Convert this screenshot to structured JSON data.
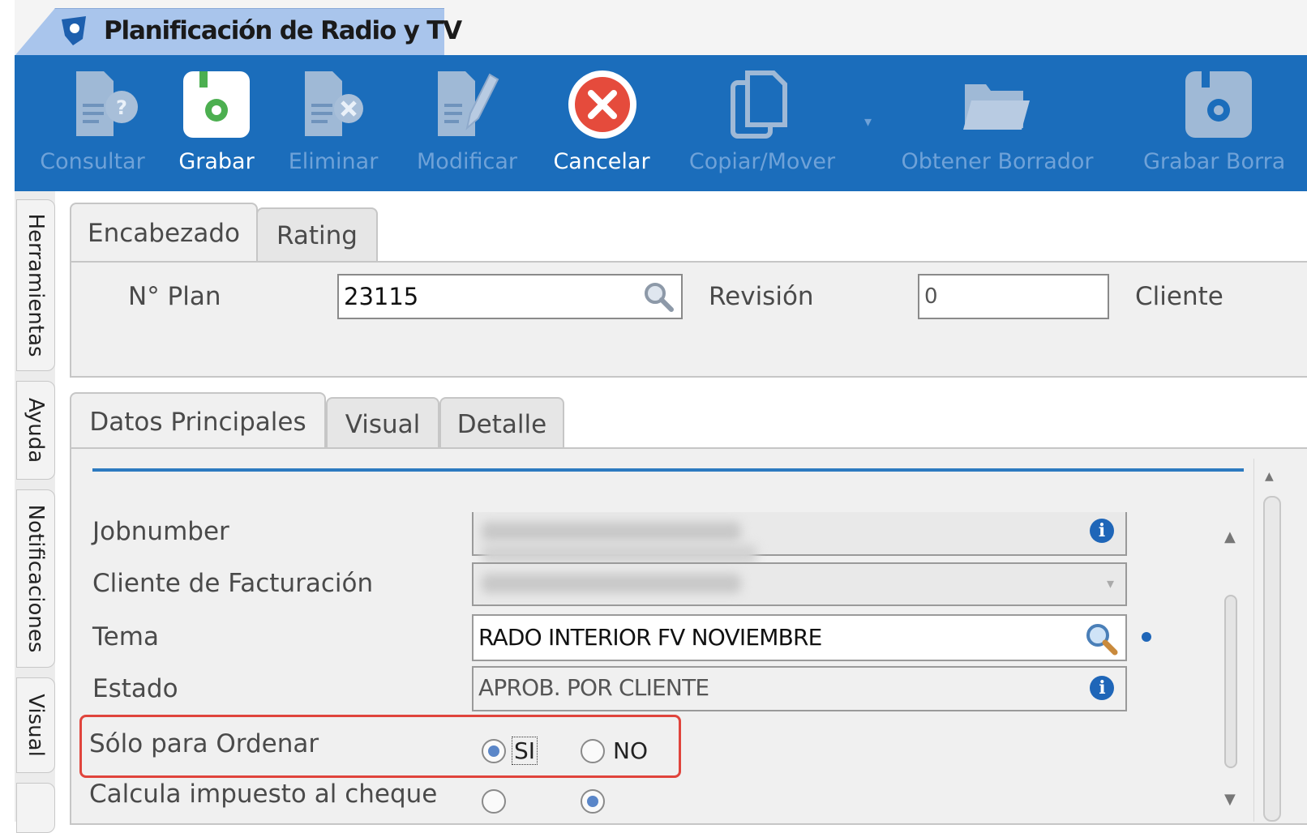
{
  "window": {
    "title": "Planificación de Radio y TV"
  },
  "toolbar": {
    "buttons": [
      {
        "label": "Consultar",
        "icon": "document-query-icon",
        "enabled": false
      },
      {
        "label": "Grabar",
        "icon": "save-icon",
        "enabled": true
      },
      {
        "label": "Eliminar",
        "icon": "document-delete-icon",
        "enabled": false
      },
      {
        "label": "Modificar",
        "icon": "document-edit-icon",
        "enabled": false
      },
      {
        "label": "Cancelar",
        "icon": "cancel-icon",
        "enabled": true
      },
      {
        "label": "Copiar/Mover",
        "icon": "copy-icon",
        "enabled": false
      },
      {
        "label": "Obtener Borrador",
        "icon": "folder-open-icon",
        "enabled": false
      },
      {
        "label": "Grabar Borra",
        "icon": "save-draft-icon",
        "enabled": false
      }
    ]
  },
  "side_tabs": [
    "Herramientas",
    "Ayuda",
    "Notificaciones",
    "Visual"
  ],
  "header_tabs": [
    {
      "label": "Encabezado",
      "active": true
    },
    {
      "label": "Rating",
      "active": false
    }
  ],
  "header": {
    "plan_label": "N° Plan",
    "plan_value": "23115",
    "revision_label": "Revisión",
    "revision_value": "0",
    "cliente_label": "Cliente"
  },
  "detail_tabs": [
    {
      "label": "Datos Principales",
      "active": true
    },
    {
      "label": "Visual",
      "active": false
    },
    {
      "label": "Detalle",
      "active": false
    }
  ],
  "form": {
    "jobnumber_label": "Jobnumber",
    "cliente_facturacion_label": "Cliente de Facturación",
    "tema_label": "Tema",
    "tema_value": "RADO INTERIOR FV NOVIEMBRE",
    "estado_label": "Estado",
    "estado_value": "APROB. POR CLIENTE",
    "solo_ordenar_label": "Sólo para Ordenar",
    "solo_ordenar_options": [
      "SI",
      "NO"
    ],
    "solo_ordenar_selected": "SI",
    "calcula_impuesto_label": "Calcula impuesto al cheque"
  },
  "colors": {
    "toolbar_bg": "#1b6dbb",
    "title_tab_bg": "#a9c5ec",
    "highlight_border": "#e0443c",
    "accent_line": "#2d7ac0"
  }
}
